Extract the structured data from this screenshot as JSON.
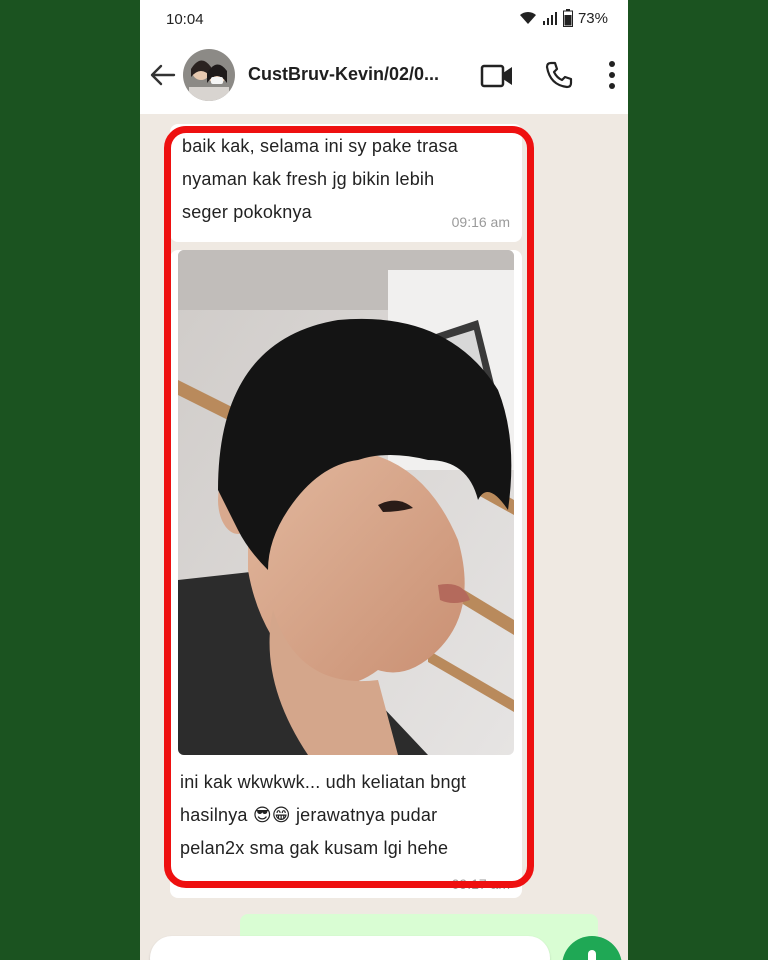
{
  "status_bar": {
    "time": "10:04",
    "battery": "73%",
    "icons": [
      "wifi-icon",
      "signal-icon",
      "battery-icon"
    ]
  },
  "header": {
    "contact_name": "CustBruv-Kevin/02/0...",
    "icons": [
      "back-arrow-icon",
      "video-call-icon",
      "phone-icon",
      "more-vert-icon"
    ]
  },
  "messages": [
    {
      "lines": [
        "baik kak, selama ini sy pake trasa",
        "nyaman kak fresh jg bikin lebih",
        "seger pokoknya"
      ],
      "time": "09:16 am"
    },
    {
      "caption_lines": [
        "ini kak wkwkwk... udh keliatan bngt",
        "hasilnya 😎😁 jerawatnya pudar",
        "pelan2x sma gak kusam lgi hehe"
      ],
      "time": "09:17 am"
    }
  ],
  "colors": {
    "highlight": "#ee1010",
    "background": "#1b5320",
    "chat_bg": "#efe9e2",
    "accent": "#1fa855"
  }
}
